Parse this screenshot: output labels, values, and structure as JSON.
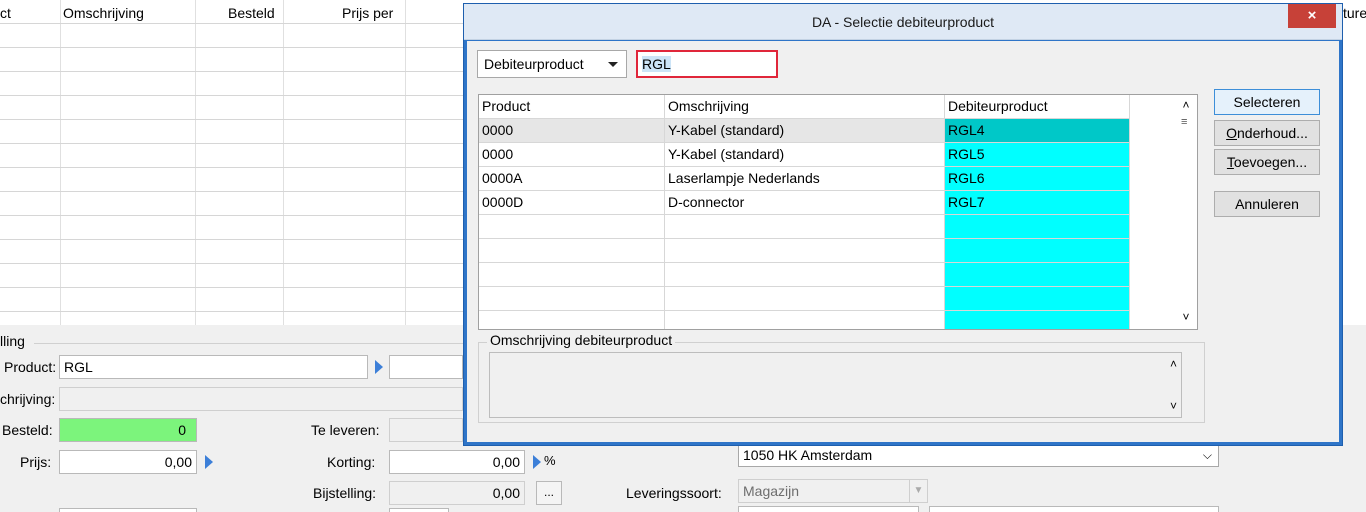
{
  "background": {
    "grid_headers": [
      "ct",
      "Omschrijving",
      "Besteld",
      "Prijs per"
    ],
    "right_header_fragment": "ture",
    "group_label": "lling",
    "form": {
      "product_label": "Product:",
      "product_value": "RGL",
      "omschrijving_label": "chrijving:",
      "besteld_label": "Besteld:",
      "besteld_value": "0",
      "prijs_label": "Prijs:",
      "prijs_value": "0,00",
      "te_leveren_label": "Te leveren:",
      "korting_label": "Korting:",
      "korting_value": "0,00",
      "korting_unit": "%",
      "bijstelling_label": "Bijstelling:",
      "bijstelling_value": "0,00",
      "bijstelling_button": "...",
      "address_value": "1050 HK  Amsterdam",
      "leveringssoort_label": "Leveringssoort:",
      "leveringssoort_value": "Magazijn"
    }
  },
  "dialog": {
    "title": "DA - Selectie debiteurproduct",
    "close_label": "×",
    "search_type": "Debiteurproduct",
    "search_value": "RGL",
    "columns": [
      "Product",
      "Omschrijving",
      "Debiteurproduct"
    ],
    "rows": [
      {
        "product": "0000",
        "omschrijving": "Y-Kabel (standard)",
        "debiteurproduct": "RGL4"
      },
      {
        "product": "0000",
        "omschrijving": "Y-Kabel (standard)",
        "debiteurproduct": "RGL5"
      },
      {
        "product": "0000A",
        "omschrijving": "Laserlampje Nederlands",
        "debiteurproduct": "RGL6"
      },
      {
        "product": "0000D",
        "omschrijving": "D-connector",
        "debiteurproduct": "RGL7"
      }
    ],
    "buttons": {
      "selecteren": "Selecteren",
      "onderhoud_first": "O",
      "onderhoud_rest": "nderhoud...",
      "toevoegen_first": "T",
      "toevoegen_rest": "oevoegen...",
      "annuleren": "Annuleren"
    },
    "description_legend": "Omschrijving debiteurproduct"
  },
  "colors": {
    "selected_row_cyan": "#00c8c8",
    "cyan": "#00ffff",
    "green_field": "#7cf47c",
    "close_button": "#c74138",
    "dialog_border": "#2f75c8"
  }
}
